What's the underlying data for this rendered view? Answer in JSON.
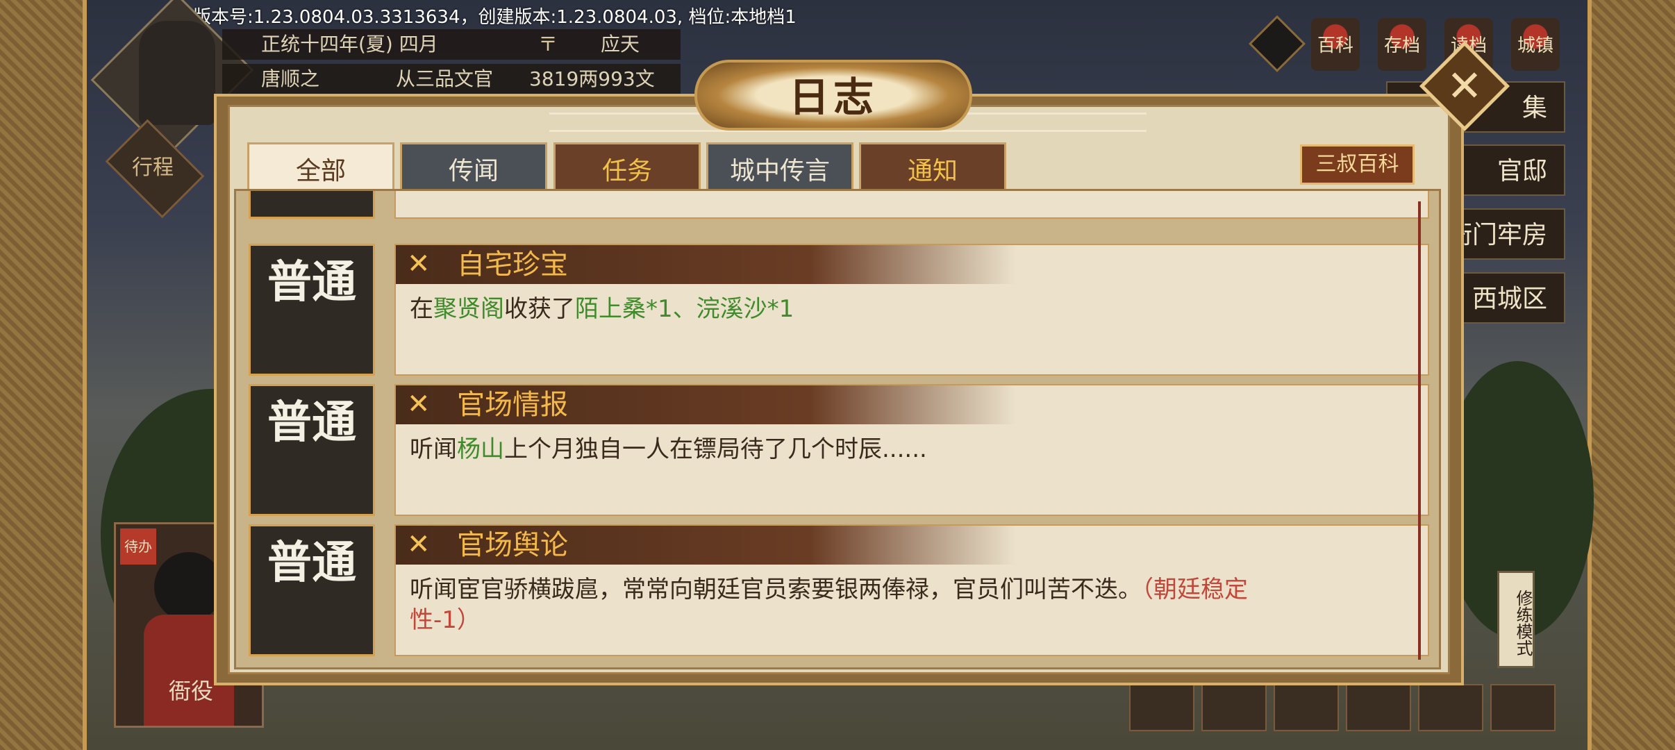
{
  "hud": {
    "version": "版本号:1.23.0804.03.3313634，创建版本:1.23.0804.03, 档位:本地档1",
    "date": "正统十四年(夏) 四月",
    "city": "应天",
    "player_name": "唐顺之",
    "rank": "从三品文官",
    "money": "3819两993文",
    "trip_button": "行程",
    "icons": [
      {
        "label": "百科",
        "icon": "encyclopedia-icon"
      },
      {
        "label": "存档",
        "icon": "save-icon"
      },
      {
        "label": "读档",
        "icon": "load-icon"
      },
      {
        "label": "城镇",
        "icon": "town-icon"
      }
    ],
    "side_buttons": [
      "集",
      "官邸",
      "衙门牢房",
      "西城区"
    ],
    "npc_label": "衙役",
    "npc_badge": "待办",
    "practice_mode": "修练模式"
  },
  "dialog": {
    "title": "日志",
    "close_icon": "close-icon",
    "tabs": [
      {
        "label": "全部",
        "state": "active"
      },
      {
        "label": "传闻",
        "state": "normal"
      },
      {
        "label": "任务",
        "state": "normal"
      },
      {
        "label": "城中传言",
        "state": "normal"
      },
      {
        "label": "通知",
        "state": "normal"
      }
    ],
    "baike_button": "三叔百科",
    "entries": [
      {
        "badge": "普通",
        "title": "自宅珍宝",
        "body": [
          {
            "t": "在",
            "c": "n"
          },
          {
            "t": "聚贤阁",
            "c": "g"
          },
          {
            "t": "收获了",
            "c": "n"
          },
          {
            "t": "陌上桑*1、浣溪沙*1",
            "c": "g"
          }
        ]
      },
      {
        "badge": "普通",
        "title": "官场情报",
        "body": [
          {
            "t": "听闻",
            "c": "n"
          },
          {
            "t": "杨山",
            "c": "g"
          },
          {
            "t": "上个月独自一人在镖局待了几个时辰......",
            "c": "n"
          }
        ]
      },
      {
        "badge": "普通",
        "title": "官场舆论",
        "body": [
          {
            "t": "听闻宦官骄横跋扈，常常向朝廷官员索要银两俸禄，官员们叫苦不迭。",
            "c": "n"
          },
          {
            "t": "（朝廷稳定性-1）",
            "c": "r"
          }
        ]
      }
    ],
    "colors": {
      "green": "#3f8a2a",
      "red": "#c2473a",
      "gold": "#f3b94a"
    }
  }
}
